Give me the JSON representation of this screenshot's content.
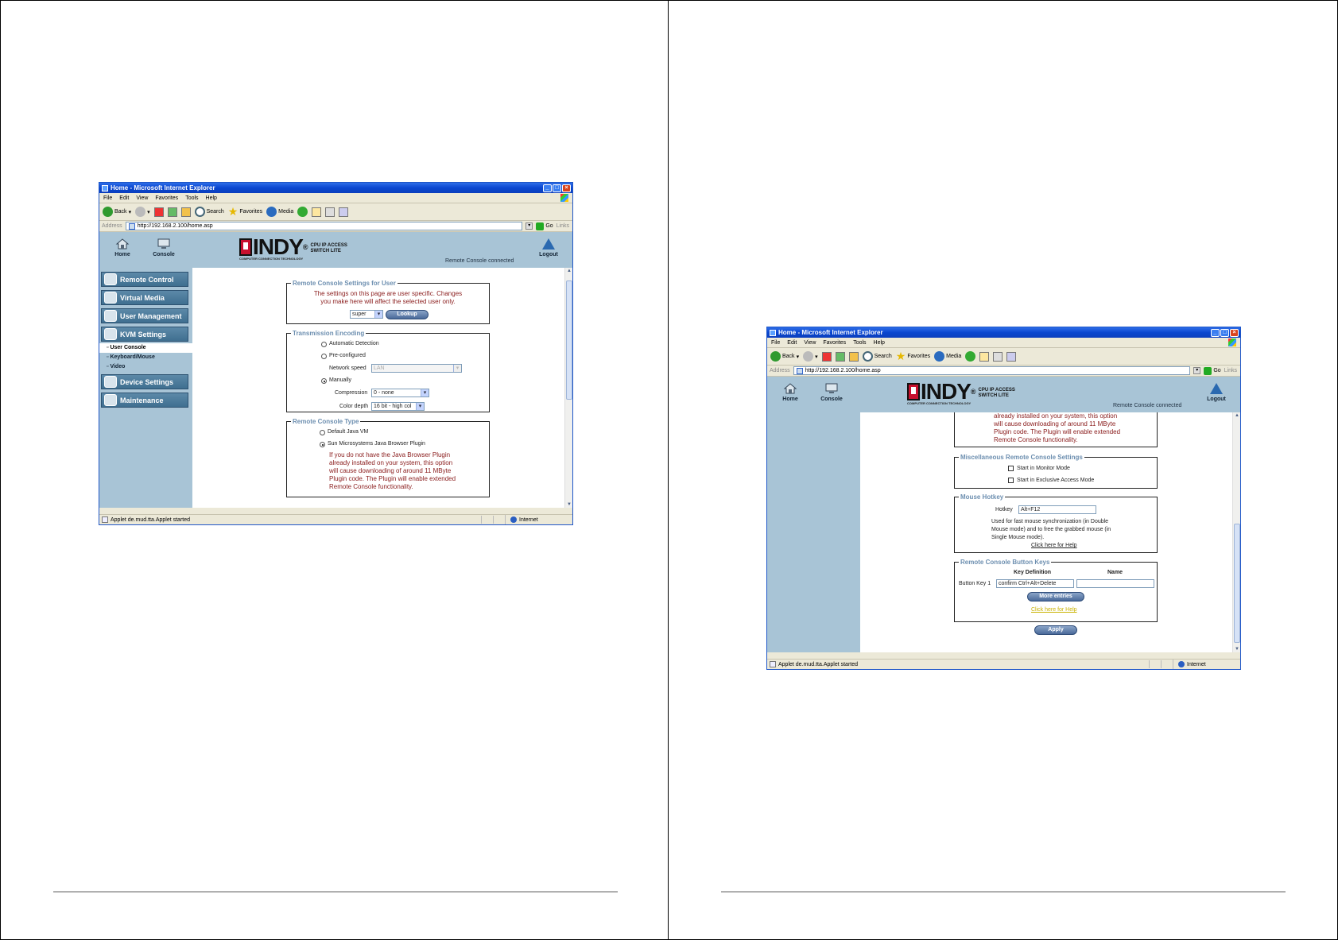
{
  "ie": {
    "title": "Home - Microsoft Internet Explorer",
    "menu": [
      "File",
      "Edit",
      "View",
      "Favorites",
      "Tools",
      "Help"
    ],
    "toolbar": {
      "back": "Back",
      "search": "Search",
      "favorites": "Favorites",
      "media": "Media"
    },
    "address_label": "Address",
    "url": "http://192.168.2.100/home.asp",
    "go": "Go",
    "links": "Links",
    "status_text": "Applet de.mud.tta.Applet started",
    "zone": "Internet"
  },
  "app": {
    "home": "Home",
    "console": "Console",
    "logout": "Logout",
    "logo_word": "INDY",
    "logo_reg": "®",
    "logo_sub_line1": "CPU IP ACCESS",
    "logo_sub_line2": "SWITCH LITE",
    "tagline": "COMPUTER CONNECTION TECHNOLOGY",
    "connection_status": "Remote Console connected"
  },
  "sidebar": {
    "items": [
      "Remote Control",
      "Virtual Media",
      "User Management",
      "KVM Settings",
      "Device Settings",
      "Maintenance"
    ],
    "sub_items": [
      "User Console",
      "Keyboard/Mouse",
      "Video"
    ]
  },
  "left": {
    "settings_for_user": {
      "legend": "Remote Console Settings for User",
      "note_line1": "The settings on this page are user specific. Changes",
      "note_line2": "you make here will affect the selected user only.",
      "user_value": "super",
      "lookup": "Lookup"
    },
    "encoding": {
      "legend": "Transmission Encoding",
      "automatic": "Automatic Detection",
      "preconfigured": "Pre-configured",
      "network_speed_label": "Network speed",
      "network_speed_value": "LAN",
      "manually": "Manually",
      "compression_label": "Compression",
      "compression_value": "0 - none",
      "color_depth_label": "Color depth",
      "color_depth_value": "16 bit - high col"
    },
    "console_type": {
      "legend": "Remote Console Type",
      "default_vm": "Default Java VM",
      "sun_plugin": "Sun Microsystems Java Browser Plugin",
      "note_line1": "If you do not have the Java Browser Plugin",
      "note_line2": "already installed on your system, this option",
      "note_line3": "will cause downloading of around 11 MByte",
      "note_line4": "Plugin code. The Plugin will enable extended",
      "note_line5": "Remote Console functionality."
    }
  },
  "right": {
    "partial_note": {
      "line1": "already installed on your system, this option",
      "line2": "will cause downloading of around 11 MByte",
      "line3": "Plugin code. The Plugin will enable extended",
      "line4": "Remote Console functionality."
    },
    "misc": {
      "legend": "Miscellaneous Remote Console Settings",
      "monitor_mode": "Start in Monitor Mode",
      "exclusive_mode": "Start in Exclusive Access Mode"
    },
    "hotkey": {
      "legend": "Mouse Hotkey",
      "label": "Hotkey",
      "value": "Alt+F12",
      "desc_line1": "Used for fast mouse synchronization (in Double",
      "desc_line2": "Mouse mode) and to free the grabbed mouse (in",
      "desc_line3": "Single Mouse mode).",
      "help": "Click here for Help"
    },
    "button_keys": {
      "legend": "Remote Console Button Keys",
      "col_key_def": "Key Definition",
      "col_name": "Name",
      "row_label": "Button Key 1",
      "row_value": "confirm Ctrl+Alt+Delete",
      "row_name": "",
      "more_entries": "More entries",
      "help": "Click here for Help"
    },
    "apply": "Apply"
  }
}
